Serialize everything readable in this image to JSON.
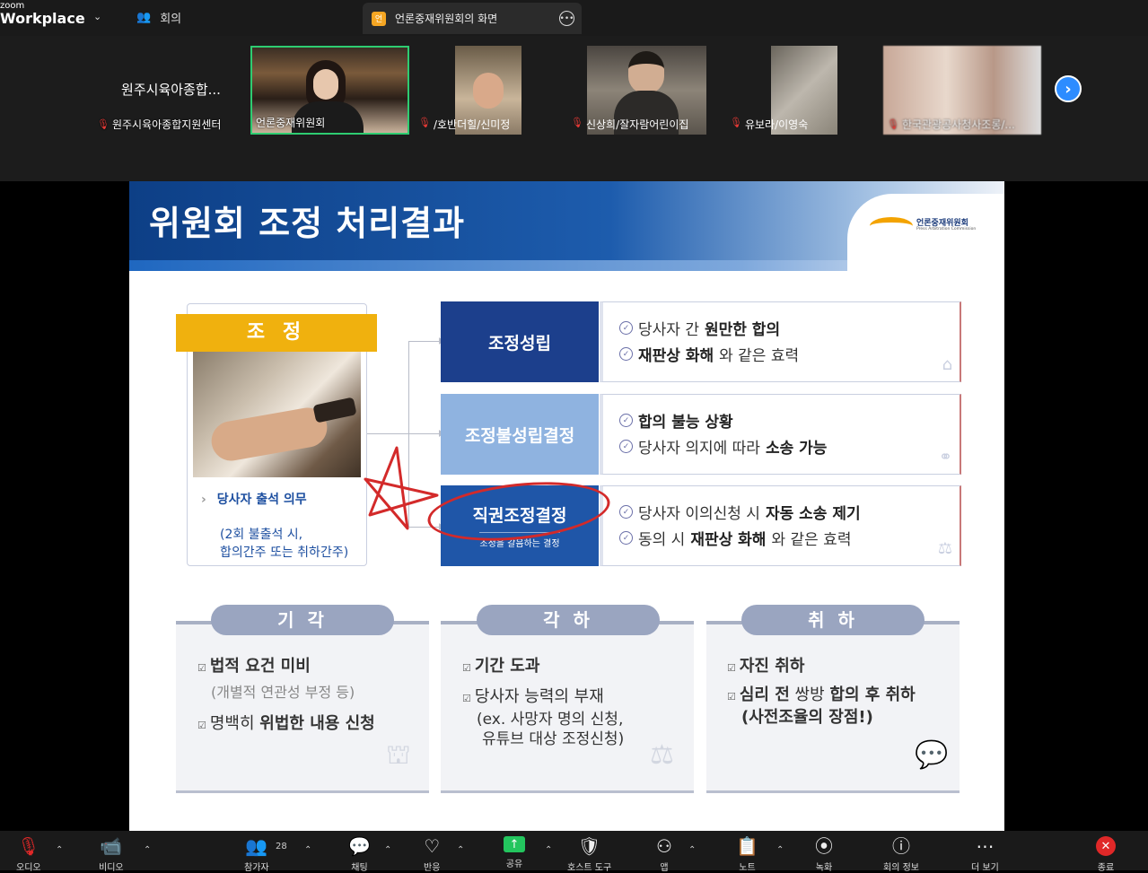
{
  "app": {
    "brand_small": "zoom",
    "brand_large": "Workplace"
  },
  "tabs": {
    "meeting_label": "회의",
    "share_badge": "언",
    "share_label": "언론중재위원회의 화면"
  },
  "participants": [
    {
      "name": "원주시육아종합지원센터",
      "tile_text": "원주시육아종합..."
    },
    {
      "name": "언론중재위원회"
    },
    {
      "name": "/호반더힐/신미정"
    },
    {
      "name": "신상희/잘자람어린이집"
    },
    {
      "name": "유보라/이영숙"
    },
    {
      "name": "한국관광공사청사조롱/..."
    }
  ],
  "slide": {
    "title": "위원회 조정 처리결과",
    "logo_name": "언론중재위원회",
    "logo_sub": "Press Arbitration Commission",
    "left": {
      "heading": "조 정",
      "label": "당사자 출석 의무",
      "note_line1": "(2회 불출석 시,",
      "note_line2": "합의간주 또는 취하간주)"
    },
    "results": [
      {
        "title": "조정성립",
        "lines": [
          [
            "당사자 간 ",
            "원만한 합의",
            ""
          ],
          [
            "",
            "재판상 화해",
            "와 같은 효력"
          ]
        ]
      },
      {
        "title": "조정불성립결정",
        "lines": [
          [
            "",
            "합의 불능 상황",
            ""
          ],
          [
            "당사자 의지에 따라 ",
            "소송 가능",
            ""
          ]
        ]
      },
      {
        "title": "직권조정결정",
        "subtitle": "조정을 갈음하는 결정",
        "lines": [
          [
            "당사자 이의신청 시 ",
            "자동 소송 제기",
            ""
          ],
          [
            "동의 시 ",
            "재판상 화해",
            "와 같은 효력"
          ]
        ]
      }
    ],
    "bottom": [
      {
        "head": "기 각",
        "l1": "법적 요건 미비",
        "l2": "(개별적 연관성 부정 등)",
        "l3_pre": "명백히 ",
        "l3_bold": "위법한 내용 신청"
      },
      {
        "head": "각 하",
        "l1": "기간 도과",
        "l2": "당사자 능력의 부재",
        "l3": "(ex. 사망자 명의 신청,",
        "l4": "유튜브 대상 조정신청)"
      },
      {
        "head": "취 하",
        "l1": "자진 취하",
        "l2_bold1": "심리 전",
        "l2_mid": " 쌍방 ",
        "l2_bold2": "합의 후 취하",
        "l3": "(사전조율의 장점!)"
      }
    ]
  },
  "toolbar": {
    "audio": "오디오",
    "video": "비디오",
    "participants": "참가자",
    "participant_count": "28",
    "chat": "채팅",
    "react": "반응",
    "share": "공유",
    "host_tools": "호스트 도구",
    "apps": "앱",
    "notes": "노트",
    "record": "녹화",
    "info": "회의 정보",
    "more": "더 보기",
    "end": "종료"
  },
  "colors": {
    "accent": "#2d8cff",
    "header_blue": "#0d3f86",
    "gold": "#f0b10e",
    "annotation_red": "#d32a2a"
  }
}
